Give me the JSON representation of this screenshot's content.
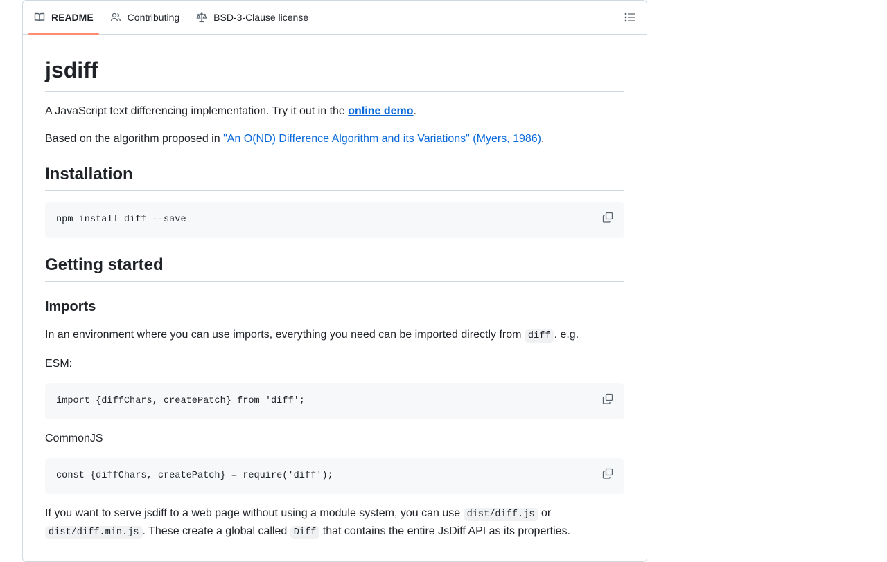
{
  "tabs": [
    {
      "label": "README",
      "icon": "book-icon",
      "active": true
    },
    {
      "label": "Contributing",
      "icon": "people-icon"
    },
    {
      "label": "BSD-3-Clause license",
      "icon": "law-icon"
    }
  ],
  "readme": {
    "title": "jsdiff",
    "intro": {
      "text": "A JavaScript text differencing implementation. Try it out in the ",
      "link": "online demo",
      "tail": "."
    },
    "based_on": {
      "text": "Based on the algorithm proposed in ",
      "link": "\"An O(ND) Difference Algorithm and its Variations\" (Myers, 1986)",
      "tail": "."
    },
    "installation": {
      "heading": "Installation",
      "code": "npm install diff --save"
    },
    "getting_started": {
      "heading": "Getting started",
      "imports_heading": "Imports",
      "imports_text_before": "In an environment where you can use imports, everything you need can be imported directly from ",
      "imports_code": "diff",
      "imports_text_after": ". e.g.",
      "esm_label": "ESM:",
      "esm_code": "import {diffChars, createPatch} from 'diff';",
      "cjs_label": "CommonJS",
      "cjs_code": "const {diffChars, createPatch} = require('diff');",
      "serve_text_1": "If you want to serve jsdiff to a web page without using a module system, you can use ",
      "serve_code_1": "dist/diff.js",
      "serve_text_2": " or ",
      "serve_code_2": "dist/diff.min.js",
      "serve_text_3": ". These create a global called ",
      "serve_code_3": "Diff",
      "serve_text_4": " that contains the entire JsDiff API as its properties."
    }
  },
  "colors": {
    "link": "#0969da",
    "active_tab_underline": "#fd8c73",
    "code_bg": "#f6f8fa",
    "border": "#d1d9e0"
  }
}
